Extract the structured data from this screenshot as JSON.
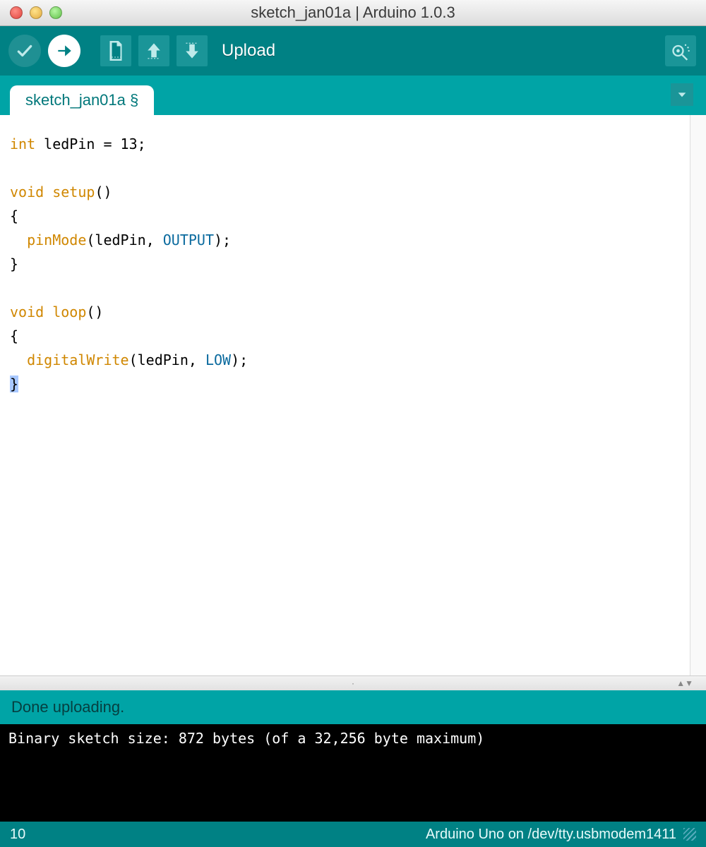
{
  "window": {
    "title": "sketch_jan01a | Arduino 1.0.3"
  },
  "toolbar": {
    "verify_name": "verify-button",
    "upload_name": "upload-button",
    "new_name": "new-button",
    "open_name": "open-button",
    "save_name": "save-button",
    "current_label": "Upload",
    "serial_name": "serial-monitor-button"
  },
  "tabs": {
    "active_label": "sketch_jan01a §"
  },
  "code": {
    "line1a": "int",
    "line1b": " ledPin = 13;",
    "line3a": "void",
    "line3b": " ",
    "line3c": "setup",
    "line3d": "()",
    "line4": "{",
    "line5a": "  ",
    "line5b": "pinMode",
    "line5c": "(ledPin, ",
    "line5d": "OUTPUT",
    "line5e": ");",
    "line6": "}",
    "line8a": "void",
    "line8b": " ",
    "line8c": "loop",
    "line8d": "()",
    "line9": "{",
    "line10a": "  ",
    "line10b": "digitalWrite",
    "line10c": "(ledPin, ",
    "line10d": "LOW",
    "line10e": ");",
    "line11": "}"
  },
  "status": {
    "message": "Done uploading."
  },
  "console": {
    "line1": "Binary sketch size: 872 bytes (of a 32,256 byte maximum)"
  },
  "footer": {
    "line_no": "10",
    "board_port": "Arduino Uno on /dev/tty.usbmodem1411"
  }
}
